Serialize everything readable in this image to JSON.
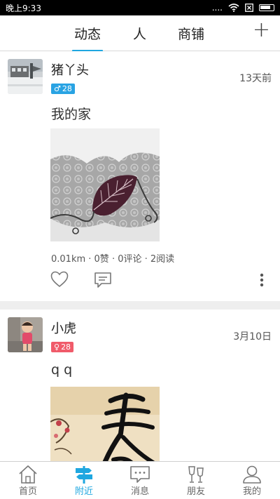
{
  "status_bar": {
    "time": "晚上9:33",
    "signal_text": "....",
    "sim_icon": "sim-off-icon",
    "battery_icon": "battery-icon"
  },
  "top_nav": {
    "tabs": [
      {
        "label": "动态",
        "active": true
      },
      {
        "label": "人",
        "active": false
      },
      {
        "label": "商铺",
        "active": false
      }
    ],
    "add_icon": "plus-icon"
  },
  "posts": [
    {
      "username": "猪丫头",
      "gender_symbol": "♂",
      "age": "28",
      "time": "13天前",
      "text": "我的家",
      "stats": "0.01km · 0赞 · 0评论 · 2阅读"
    },
    {
      "username": "小虎",
      "gender_symbol": "♀",
      "age": "28",
      "time": "3月10日",
      "text": "q q"
    }
  ],
  "bottom_nav": {
    "items": [
      {
        "label": "首页",
        "icon": "home-icon"
      },
      {
        "label": "附近",
        "icon": "signpost-icon",
        "active": true
      },
      {
        "label": "消息",
        "icon": "message-icon"
      },
      {
        "label": "朋友",
        "icon": "friends-glasses-icon"
      },
      {
        "label": "我的",
        "icon": "profile-icon"
      }
    ]
  },
  "colors": {
    "accent": "#1fa7e0",
    "male_badge": "#29a3e3",
    "female_badge": "#f05b6a",
    "separator": "#eeeeee"
  }
}
